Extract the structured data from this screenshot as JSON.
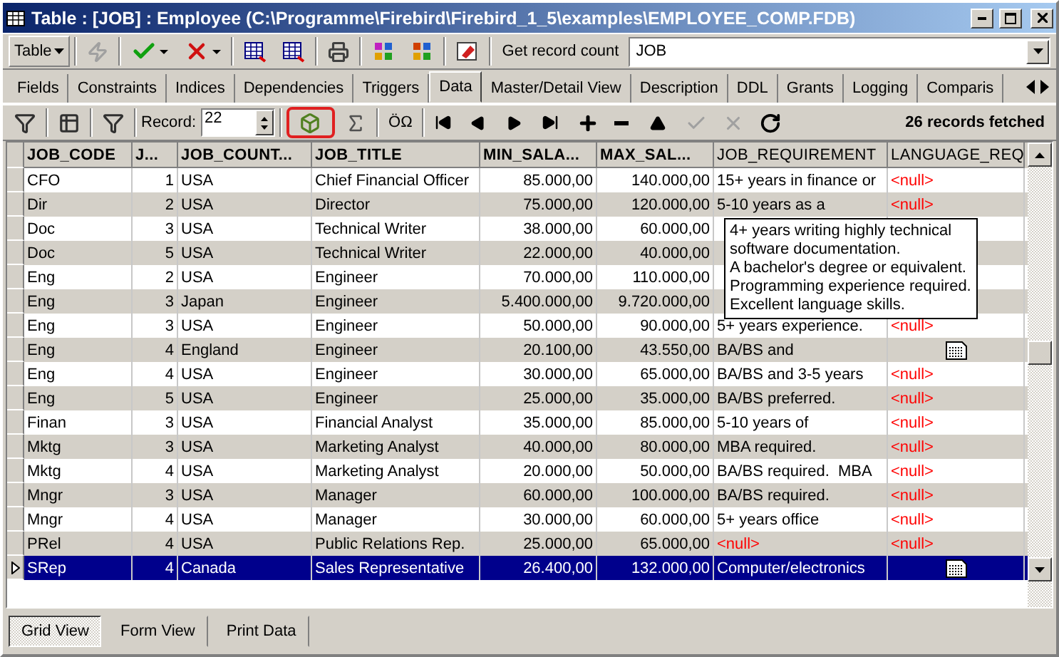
{
  "window": {
    "title": "Table : [JOB] : Employee (C:\\Programme\\Firebird\\Firebird_1_5\\examples\\EMPLOYEE_COMP.FDB)"
  },
  "toolbar": {
    "table_menu": "Table",
    "count_button": "Get record count",
    "object_combo": "JOB"
  },
  "tabs": [
    {
      "label": "Fields",
      "selected": false
    },
    {
      "label": "Constraints",
      "selected": false
    },
    {
      "label": "Indices",
      "selected": false
    },
    {
      "label": "Dependencies",
      "selected": false
    },
    {
      "label": "Triggers",
      "selected": false
    },
    {
      "label": "Data",
      "selected": true
    },
    {
      "label": "Master/Detail View",
      "selected": false
    },
    {
      "label": "Description",
      "selected": false
    },
    {
      "label": "DDL",
      "selected": false
    },
    {
      "label": "Grants",
      "selected": false
    },
    {
      "label": "Logging",
      "selected": false
    },
    {
      "label": "Comparis",
      "selected": false
    }
  ],
  "data_toolbar": {
    "record_label": "Record:",
    "record_value": "22",
    "cube_highlighted": true,
    "special_chars": "ÖΩ",
    "status": "26 records fetched"
  },
  "table": {
    "columns": [
      "JOB_CODE",
      "J...",
      "JOB_COUNT...",
      "JOB_TITLE",
      "MIN_SALA...",
      "MAX_SAL...",
      "JOB_REQUIREMENT",
      "LANGUAGE_REQ"
    ],
    "rows": [
      {
        "selected": false,
        "cells": [
          "CFO",
          "1",
          "USA",
          "Chief Financial Officer",
          "85.000,00",
          "140.000,00"
        ],
        "requirement": {
          "kind": "text",
          "text": "15+ years in finance or"
        },
        "language": {
          "kind": "null",
          "text": "<null>"
        }
      },
      {
        "selected": false,
        "cells": [
          "Dir",
          "2",
          "USA",
          "Director",
          "75.000,00",
          "120.000,00"
        ],
        "requirement": {
          "kind": "text",
          "text": "5-10 years as a"
        },
        "language": {
          "kind": "null",
          "text": "<null>"
        }
      },
      {
        "selected": false,
        "cells": [
          "Doc",
          "3",
          "USA",
          "Technical Writer",
          "38.000,00",
          "60.000,00"
        ]
      },
      {
        "selected": false,
        "cells": [
          "Doc",
          "5",
          "USA",
          "Technical Writer",
          "22.000,00",
          "40.000,00"
        ]
      },
      {
        "selected": false,
        "cells": [
          "Eng",
          "2",
          "USA",
          "Engineer",
          "70.000,00",
          "110.000,00"
        ]
      },
      {
        "selected": false,
        "cells": [
          "Eng",
          "3",
          "Japan",
          "Engineer",
          "5.400.000,00",
          "9.720.000,00"
        ]
      },
      {
        "selected": false,
        "cells": [
          "Eng",
          "3",
          "USA",
          "Engineer",
          "50.000,00",
          "90.000,00"
        ],
        "requirement": {
          "kind": "text",
          "text": "5+ years experience."
        },
        "language": {
          "kind": "null",
          "text": "<null>"
        }
      },
      {
        "selected": false,
        "cells": [
          "Eng",
          "4",
          "England",
          "Engineer",
          "20.100,00",
          "43.550,00"
        ],
        "requirement": {
          "kind": "text",
          "text": "BA/BS and"
        },
        "language": {
          "kind": "memo"
        }
      },
      {
        "selected": false,
        "cells": [
          "Eng",
          "4",
          "USA",
          "Engineer",
          "30.000,00",
          "65.000,00"
        ],
        "requirement": {
          "kind": "text",
          "text": "BA/BS and 3-5 years"
        },
        "language": {
          "kind": "null",
          "text": "<null>"
        }
      },
      {
        "selected": false,
        "cells": [
          "Eng",
          "5",
          "USA",
          "Engineer",
          "25.000,00",
          "35.000,00"
        ],
        "requirement": {
          "kind": "text",
          "text": "BA/BS preferred."
        },
        "language": {
          "kind": "null",
          "text": "<null>"
        }
      },
      {
        "selected": false,
        "cells": [
          "Finan",
          "3",
          "USA",
          "Financial Analyst",
          "35.000,00",
          "85.000,00"
        ],
        "requirement": {
          "kind": "text",
          "text": "5-10 years of"
        },
        "language": {
          "kind": "null",
          "text": "<null>"
        }
      },
      {
        "selected": false,
        "cells": [
          "Mktg",
          "3",
          "USA",
          "Marketing Analyst",
          "40.000,00",
          "80.000,00"
        ],
        "requirement": {
          "kind": "text",
          "text": "MBA required."
        },
        "language": {
          "kind": "null",
          "text": "<null>"
        }
      },
      {
        "selected": false,
        "cells": [
          "Mktg",
          "4",
          "USA",
          "Marketing Analyst",
          "20.000,00",
          "50.000,00"
        ],
        "requirement": {
          "kind": "text",
          "text": "BA/BS required.  MBA"
        },
        "language": {
          "kind": "null",
          "text": "<null>"
        }
      },
      {
        "selected": false,
        "cells": [
          "Mngr",
          "3",
          "USA",
          "Manager",
          "60.000,00",
          "100.000,00"
        ],
        "requirement": {
          "kind": "text",
          "text": "BA/BS required."
        },
        "language": {
          "kind": "null",
          "text": "<null>"
        }
      },
      {
        "selected": false,
        "cells": [
          "Mngr",
          "4",
          "USA",
          "Manager",
          "30.000,00",
          "60.000,00"
        ],
        "requirement": {
          "kind": "text",
          "text": "5+ years office"
        },
        "language": {
          "kind": "null",
          "text": "<null>"
        }
      },
      {
        "selected": false,
        "cells": [
          "PRel",
          "4",
          "USA",
          "Public Relations Rep.",
          "25.000,00",
          "65.000,00"
        ],
        "requirement": {
          "kind": "null",
          "text": "<null>"
        },
        "language": {
          "kind": "null",
          "text": "<null>"
        }
      },
      {
        "selected": true,
        "cells": [
          "SRep",
          "4",
          "Canada",
          "Sales Representative",
          "26.400,00",
          "132.000,00"
        ],
        "requirement": {
          "kind": "text",
          "text": "Computer/electronics"
        },
        "language": {
          "kind": "memo"
        }
      }
    ],
    "tooltip": [
      "4+ years writing highly technical",
      "software documentation.",
      "A bachelor's degree or equivalent.",
      "Programming experience required.",
      "Excellent language skills."
    ]
  },
  "views": [
    {
      "label": "Grid View",
      "selected": true
    },
    {
      "label": "Form View",
      "selected": false
    },
    {
      "label": "Print Data",
      "selected": false
    }
  ]
}
